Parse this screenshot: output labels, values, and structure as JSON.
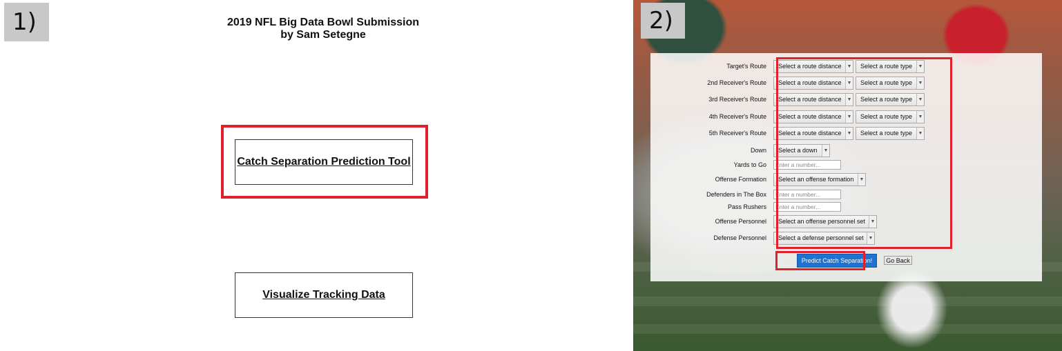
{
  "panel1": {
    "badge": "1)",
    "title_line1": "2019 NFL Big Data Bowl Submission",
    "title_line2": "by Sam Setegne",
    "catch_tool_link": "Catch Separation Prediction Tool",
    "visualize_link": "Visualize Tracking Data",
    "highlight_color": "#e0202a"
  },
  "panel2": {
    "badge": "2)",
    "routes": [
      {
        "label": "Target's Route",
        "distance": "Select a route distance",
        "type": "Select a route type"
      },
      {
        "label": "2nd Receiver's Route",
        "distance": "Select a route distance",
        "type": "Select a route type"
      },
      {
        "label": "3rd Receiver's Route",
        "distance": "Select a route distance",
        "type": "Select a route type"
      },
      {
        "label": "4th Receiver's Route",
        "distance": "Select a route distance",
        "type": "Select a route type"
      },
      {
        "label": "5th Receiver's Route",
        "distance": "Select a route distance",
        "type": "Select a route type"
      }
    ],
    "down": {
      "label": "Down",
      "value": "Select a down"
    },
    "yards_to_go": {
      "label": "Yards to Go",
      "placeholder": "Enter a number..."
    },
    "offense_formation": {
      "label": "Offense Formation",
      "value": "Select an offense formation"
    },
    "defenders_in_box": {
      "label": "Defenders in The Box",
      "placeholder": "Enter a number..."
    },
    "pass_rushers": {
      "label": "Pass Rushers",
      "placeholder": "Enter a number..."
    },
    "offense_personnel": {
      "label": "Offense Personnel",
      "value": "Select an offense personnel set"
    },
    "defense_personnel": {
      "label": "Defense Personnel",
      "value": "Select a defense personnel set"
    },
    "predict_button": "Predict Catch Separation!",
    "back_button": "Go Back",
    "button_color": "#1e72d0",
    "highlight_color": "#e0202a"
  }
}
